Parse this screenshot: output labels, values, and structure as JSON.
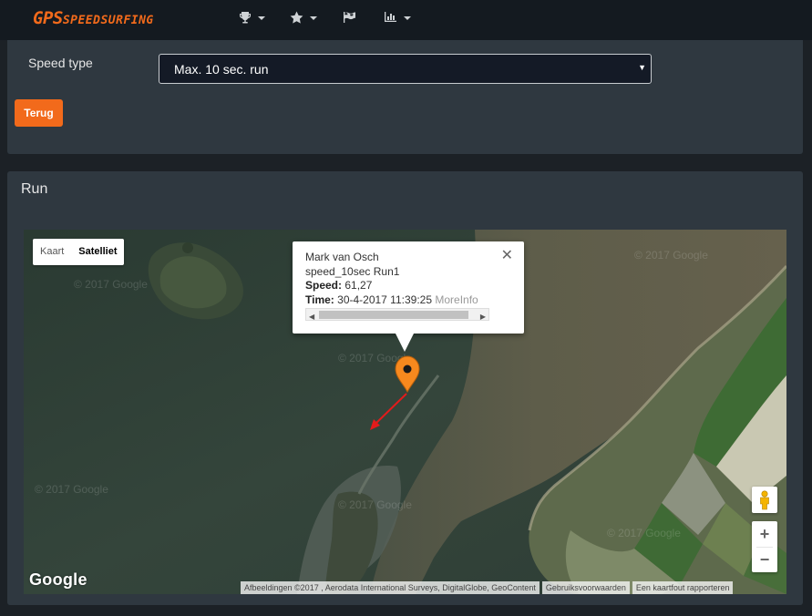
{
  "navbar": {
    "brand_big": "GPS",
    "brand_small": "SPEEDSURFING",
    "brand_color": "#f26a1b",
    "items": [
      {
        "icon": "trophy-icon",
        "has_caret": true
      },
      {
        "icon": "star-icon",
        "has_caret": true
      },
      {
        "icon": "flag-icon",
        "has_caret": false
      },
      {
        "icon": "bar-chart-icon",
        "has_caret": true
      }
    ]
  },
  "filter": {
    "speed_type_label": "Speed type",
    "selected": "Max. 10 sec. run",
    "back_button": "Terug"
  },
  "run": {
    "title": "Run"
  },
  "map": {
    "type_buttons": [
      "Kaart",
      "Satelliet"
    ],
    "active_type": "Satelliet",
    "infowindow": {
      "name": "Mark van Osch",
      "run": "speed_10sec Run1",
      "speed_label": "Speed:",
      "speed_value": "61,27",
      "time_label": "Time:",
      "time_value": "30-4-2017 11:39:25",
      "more_info": "MoreInfo",
      "close": "✕"
    },
    "watermarks": [
      "© 2017 Google",
      "© 2017 Google",
      "© 2017 Google",
      "© 2017 Google",
      "© 2017 Google",
      "© 2017 Google"
    ],
    "zoom_in": "+",
    "zoom_out": "−",
    "logo": "Google",
    "attribution": "Afbeeldingen ©2017 , Aerodata International Surveys, DigitalGlobe, GeoContent",
    "terms": "Gebruiksvoorwaarden",
    "report": "Een kaartfout rapporteren",
    "marker_color": "#f7891e",
    "track_color": "#e31b1b"
  }
}
